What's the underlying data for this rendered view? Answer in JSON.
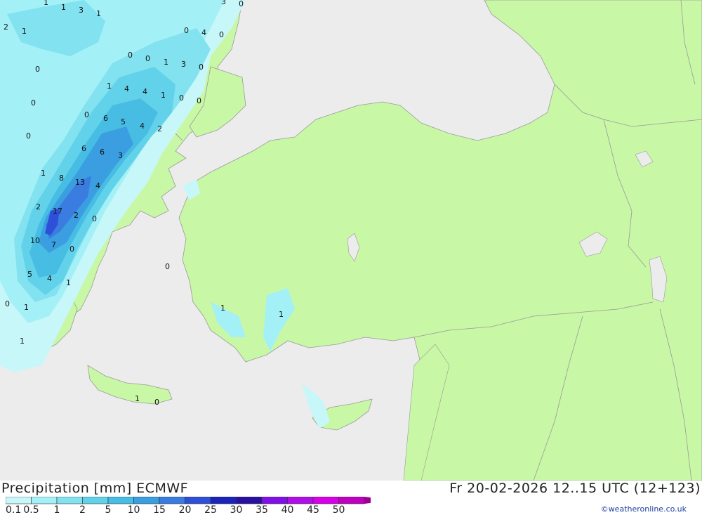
{
  "title": "Precipitation [mm] ECMWF",
  "valid_time": "Fr 20-02-2026 12..15 UTC (12+123)",
  "credit": "©weatheronline.co.uk",
  "colors": {
    "sea": "#ececec",
    "land": "#c8f7a6",
    "border": "#9a9a9a"
  },
  "legend": {
    "ticks": [
      "0.1",
      "0.5",
      "1",
      "2",
      "5",
      "10",
      "15",
      "20",
      "25",
      "30",
      "35",
      "40",
      "45",
      "50"
    ],
    "colors": [
      "#c8f7fa",
      "#a4f0f7",
      "#82e2f0",
      "#62d2ea",
      "#47bde4",
      "#3a9ee0",
      "#3a7ce0",
      "#2e4fd8",
      "#1a24b8",
      "#2a10a0",
      "#8010e8",
      "#b010e8",
      "#d800e8",
      "#c000c0",
      "#9c0090"
    ]
  },
  "map_labels": [
    "1",
    "1",
    "3",
    "1",
    "3",
    "0",
    "2",
    "1",
    "0",
    "4",
    "0",
    "0",
    "0",
    "1",
    "3",
    "0",
    "0",
    "1",
    "4",
    "4",
    "1",
    "0",
    "0",
    "0",
    "6",
    "5",
    "4",
    "2",
    "0",
    "0",
    "6",
    "6",
    "3",
    "1",
    "8",
    "13",
    "4",
    "2",
    "17",
    "2",
    "0",
    "10",
    "7",
    "0",
    "0",
    "5",
    "4",
    "1",
    "0",
    "1",
    "1",
    "1",
    "1",
    "1",
    "0"
  ]
}
